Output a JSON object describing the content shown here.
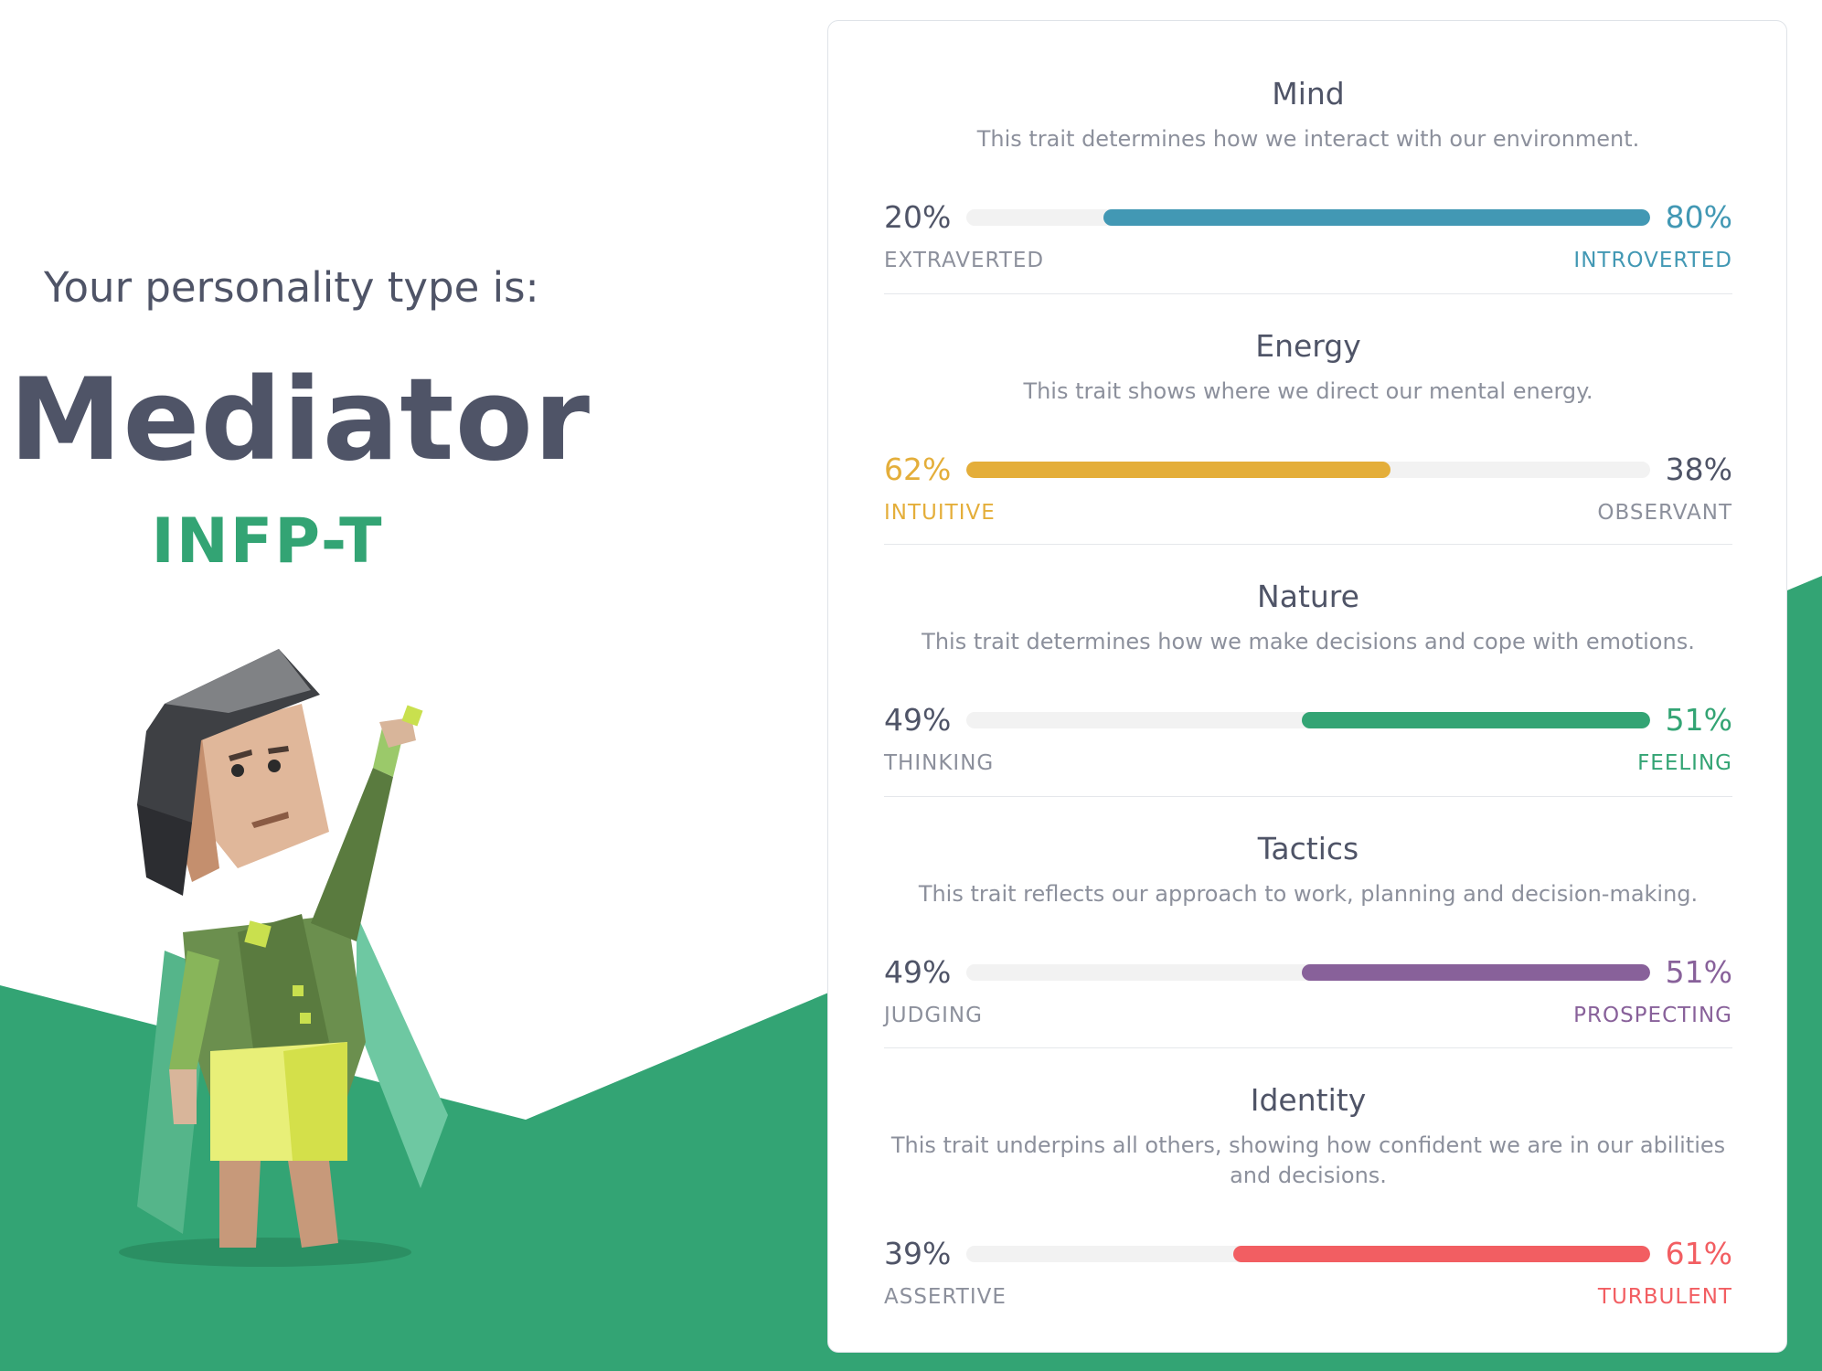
{
  "result": {
    "lead": "Your personality type is:",
    "type_name": "Mediator",
    "type_code": "INFP-T"
  },
  "colors": {
    "brand_green": "#33a474",
    "mind": "#4298b4",
    "energy": "#e4ae3a",
    "nature": "#33a474",
    "tactics": "#88619a",
    "identity": "#f25e62",
    "muted": "#8c909c",
    "dark": "#4f5467"
  },
  "illustration": {
    "icon": "mediator-character-illustration"
  },
  "traits": [
    {
      "title": "Mind",
      "description": "This trait determines how we interact with our environment.",
      "left_pct": "20%",
      "right_pct": "80%",
      "left_label": "EXTRAVERTED",
      "right_label": "INTROVERTED",
      "dominant": "right",
      "value": 80,
      "color": "#4298b4"
    },
    {
      "title": "Energy",
      "description": "This trait shows where we direct our mental energy.",
      "left_pct": "62%",
      "right_pct": "38%",
      "left_label": "INTUITIVE",
      "right_label": "OBSERVANT",
      "dominant": "left",
      "value": 62,
      "color": "#e4ae3a"
    },
    {
      "title": "Nature",
      "description": "This trait determines how we make decisions and cope with emotions.",
      "left_pct": "49%",
      "right_pct": "51%",
      "left_label": "THINKING",
      "right_label": "FEELING",
      "dominant": "right",
      "value": 51,
      "color": "#33a474"
    },
    {
      "title": "Tactics",
      "description": "This trait reflects our approach to work, planning and decision-making.",
      "left_pct": "49%",
      "right_pct": "51%",
      "left_label": "JUDGING",
      "right_label": "PROSPECTING",
      "dominant": "right",
      "value": 51,
      "color": "#88619a"
    },
    {
      "title": "Identity",
      "description": "This trait underpins all others, showing how confident we are in our abilities and decisions.",
      "left_pct": "39%",
      "right_pct": "61%",
      "left_label": "ASSERTIVE",
      "right_label": "TURBULENT",
      "dominant": "right",
      "value": 61,
      "color": "#f25e62"
    }
  ]
}
